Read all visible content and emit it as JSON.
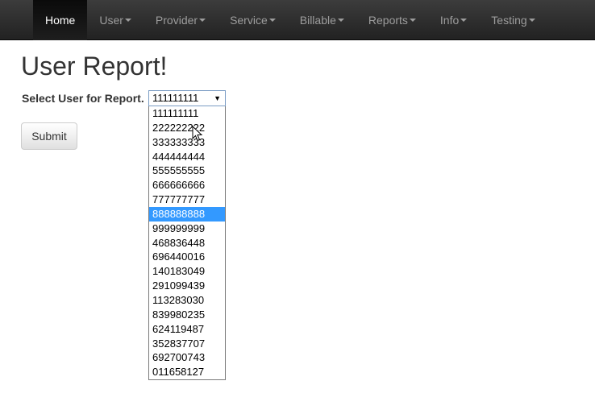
{
  "nav": {
    "items": [
      {
        "label": "Home",
        "active": true,
        "dropdown": false
      },
      {
        "label": "User",
        "active": false,
        "dropdown": true
      },
      {
        "label": "Provider",
        "active": false,
        "dropdown": true
      },
      {
        "label": "Service",
        "active": false,
        "dropdown": true
      },
      {
        "label": "Billable",
        "active": false,
        "dropdown": true
      },
      {
        "label": "Reports",
        "active": false,
        "dropdown": true
      },
      {
        "label": "Info",
        "active": false,
        "dropdown": true
      },
      {
        "label": "Testing",
        "active": false,
        "dropdown": true
      }
    ]
  },
  "main": {
    "title": "User Report!",
    "select_label": "Select User for Report.",
    "select_value": "111111111",
    "submit_label": "Submit"
  },
  "dropdown": {
    "options": [
      "111111111",
      "222222222",
      "333333333",
      "444444444",
      "555555555",
      "666666666",
      "777777777",
      "888888888",
      "999999999",
      "468836448",
      "696440016",
      "140183049",
      "291099439",
      "113283030",
      "839980235",
      "624119487",
      "352837707",
      "692700743",
      "011658127"
    ],
    "highlighted": "888888888"
  },
  "colors": {
    "navbar": "#222222",
    "highlight": "#3399ff"
  }
}
